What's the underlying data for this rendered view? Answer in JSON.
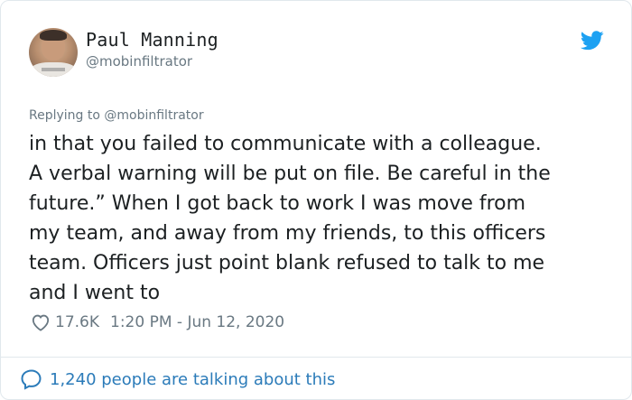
{
  "author": {
    "name": "Paul Manning",
    "handle": "@mobinfiltrator"
  },
  "reply": {
    "prefix": "Replying to ",
    "mention": "@mobinfiltrator"
  },
  "tweet": {
    "lines": [
      "in that you failed to communicate with a colleague.",
      "A verbal warning will be put on file. Be careful in the",
      "future.” When I got back to work I was move from",
      "my team, and away from my friends, to this officers",
      "team. Officers just point blank refused to talk to me",
      "and I went to"
    ]
  },
  "meta": {
    "likes": "17.6K",
    "timestamp": "1:20 PM - Jun 12, 2020"
  },
  "footer": {
    "talking": "1,240 people are talking about this"
  },
  "colors": {
    "accent": "#1da1f2",
    "link": "#2b7bb9",
    "muted": "#697882",
    "text": "#1c2022"
  },
  "icons": {
    "brand": "twitter-bird-icon",
    "like": "heart-icon",
    "conversation": "speech-bubble-icon"
  }
}
